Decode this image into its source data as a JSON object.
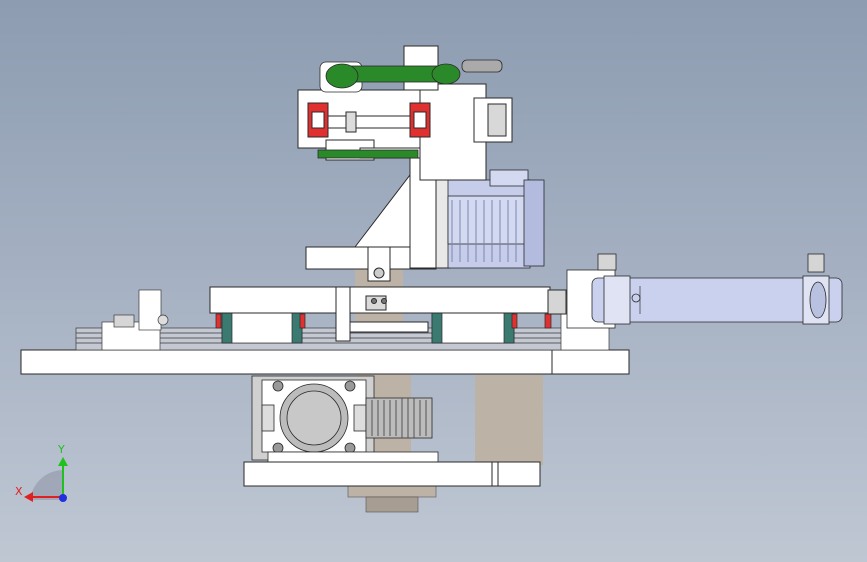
{
  "viewport": {
    "background_top": "#8d9cb1",
    "background_bottom": "#bfc7d3"
  },
  "triad": {
    "x_label": "X",
    "y_label": "Y",
    "x_color": "#e02020",
    "y_color": "#20c020",
    "z_color": "#2030e0"
  },
  "model": {
    "part_fill": "#ffffff",
    "edge_color": "#2a2a2a",
    "shadow_fill": "#bdb2a6",
    "rail_fill": "#c4c8d2",
    "motor_fill": "#c6cdea",
    "belt_color": "#2a8a2a",
    "stop_color": "#e03030",
    "carriage_color": "#3a7a70",
    "cylinder_fill": "#c9d1ee"
  }
}
